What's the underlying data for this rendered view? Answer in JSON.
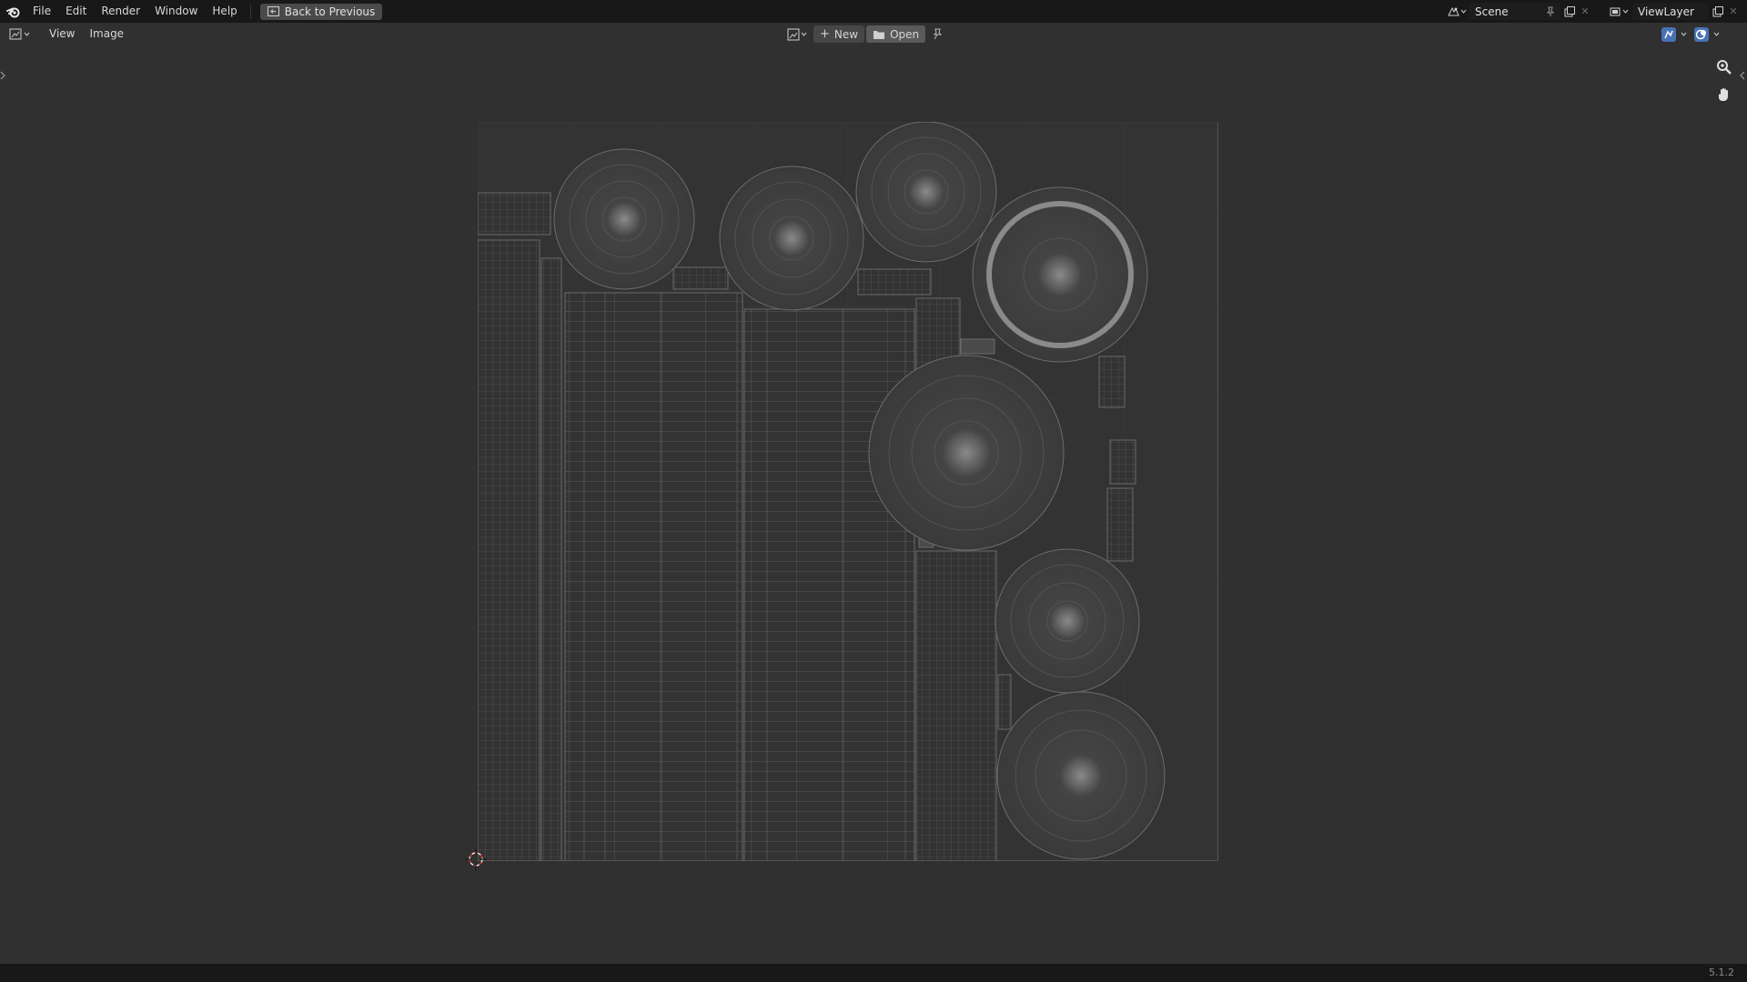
{
  "topbar": {
    "menus": [
      "File",
      "Edit",
      "Render",
      "Window",
      "Help"
    ],
    "back_label": "Back to Previous",
    "scene_name": "Scene",
    "view_layer": "ViewLayer"
  },
  "toolbar": {
    "menus": [
      "View",
      "Image"
    ],
    "new_label": "New",
    "open_label": "Open"
  },
  "status": {
    "version": "5.1.2"
  },
  "colors": {
    "background": "#303030",
    "header": "#181818",
    "uv_wire": "#7a7a7a",
    "accent": "#4772b3"
  }
}
